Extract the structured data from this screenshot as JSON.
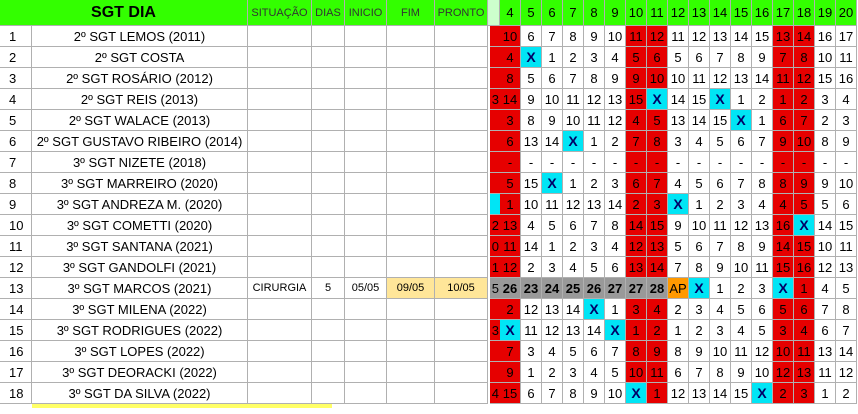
{
  "header": {
    "title": "SGT DIA",
    "columns": [
      "SITUAÇÃO",
      "DIAS",
      "INICIO",
      "FIM",
      "PRONTO"
    ],
    "days": [
      "4",
      "5",
      "6",
      "7",
      "8",
      "9",
      "10",
      "11",
      "12",
      "13",
      "14",
      "15",
      "16",
      "17",
      "18",
      "19",
      "20"
    ]
  },
  "colors": {
    "header_green": "#33ff00",
    "header_green_light": "#ccffcc",
    "red": "#e60000",
    "cyan": "#00e5f5",
    "gray": "#999999",
    "light_tan": "#ffe699",
    "orange": "#ff9900"
  },
  "rows": [
    {
      "n": "1",
      "name": "2º SGT LEMOS (2011)",
      "sit": "",
      "dias": "",
      "ini": "",
      "fim": "",
      "pronto": "",
      "pre": "",
      "pre_c": "r",
      "cells": [
        "10",
        "6",
        "7",
        "8",
        "9",
        "10",
        "11",
        "12",
        "11",
        "12",
        "13",
        "14",
        "15",
        "13",
        "14",
        "16",
        "17"
      ],
      "colors": [
        "r",
        "w",
        "w",
        "w",
        "w",
        "w",
        "r",
        "r",
        "w",
        "w",
        "w",
        "w",
        "w",
        "r",
        "r",
        "w",
        "w"
      ]
    },
    {
      "n": "2",
      "name": "2º SGT COSTA",
      "sit": "",
      "dias": "",
      "ini": "",
      "fim": "",
      "pronto": "",
      "pre": "",
      "pre_c": "r",
      "cells": [
        "4",
        "X",
        "1",
        "2",
        "3",
        "4",
        "5",
        "6",
        "5",
        "6",
        "7",
        "8",
        "9",
        "7",
        "8",
        "10",
        "11"
      ],
      "colors": [
        "r",
        "c",
        "w",
        "w",
        "w",
        "w",
        "r",
        "r",
        "w",
        "w",
        "w",
        "w",
        "w",
        "r",
        "r",
        "w",
        "w"
      ]
    },
    {
      "n": "3",
      "name": "2º SGT ROSÁRIO (2012)",
      "sit": "",
      "dias": "",
      "ini": "",
      "fim": "",
      "pronto": "",
      "pre": "",
      "pre_c": "r",
      "cells": [
        "8",
        "5",
        "6",
        "7",
        "8",
        "9",
        "9",
        "10",
        "10",
        "11",
        "12",
        "13",
        "14",
        "11",
        "12",
        "15",
        "16"
      ],
      "colors": [
        "r",
        "w",
        "w",
        "w",
        "w",
        "w",
        "r",
        "r",
        "w",
        "w",
        "w",
        "w",
        "w",
        "r",
        "r",
        "w",
        "w"
      ]
    },
    {
      "n": "4",
      "name": "2º SGT REIS (2013)",
      "sit": "",
      "dias": "",
      "ini": "",
      "fim": "",
      "pronto": "",
      "pre": "3",
      "pre_c": "r",
      "cells": [
        "14",
        "9",
        "10",
        "11",
        "12",
        "13",
        "15",
        "X",
        "14",
        "15",
        "X",
        "1",
        "2",
        "1",
        "2",
        "3",
        "4"
      ],
      "colors": [
        "r",
        "w",
        "w",
        "w",
        "w",
        "w",
        "r",
        "c",
        "w",
        "w",
        "c",
        "w",
        "w",
        "r",
        "r",
        "w",
        "w"
      ]
    },
    {
      "n": "5",
      "name": "2º SGT WALACE (2013)",
      "sit": "",
      "dias": "",
      "ini": "",
      "fim": "",
      "pronto": "",
      "pre": "",
      "pre_c": "r",
      "cells": [
        "3",
        "8",
        "9",
        "10",
        "11",
        "12",
        "4",
        "5",
        "13",
        "14",
        "15",
        "X",
        "1",
        "6",
        "7",
        "2",
        "3"
      ],
      "colors": [
        "r",
        "w",
        "w",
        "w",
        "w",
        "w",
        "r",
        "r",
        "w",
        "w",
        "w",
        "c",
        "w",
        "r",
        "r",
        "w",
        "w"
      ]
    },
    {
      "n": "6",
      "name": "2º SGT GUSTAVO RIBEIRO (2014)",
      "sit": "",
      "dias": "",
      "ini": "",
      "fim": "",
      "pronto": "",
      "pre": "",
      "pre_c": "r",
      "cells": [
        "6",
        "13",
        "14",
        "X",
        "1",
        "2",
        "7",
        "8",
        "3",
        "4",
        "5",
        "6",
        "7",
        "9",
        "10",
        "8",
        "9"
      ],
      "colors": [
        "r",
        "w",
        "w",
        "c",
        "w",
        "w",
        "r",
        "r",
        "w",
        "w",
        "w",
        "w",
        "w",
        "r",
        "r",
        "w",
        "w"
      ]
    },
    {
      "n": "7",
      "name": "3º SGT  NIZETE  (2018)",
      "sit": "",
      "dias": "",
      "ini": "",
      "fim": "",
      "pronto": "",
      "pre": "",
      "pre_c": "r",
      "cells": [
        "-",
        "-",
        "-",
        "-",
        "-",
        "-",
        "-",
        "-",
        "-",
        "-",
        "-",
        "-",
        "-",
        "-",
        "-",
        "-",
        "-"
      ],
      "colors": [
        "r",
        "w",
        "w",
        "w",
        "w",
        "w",
        "r",
        "r",
        "w",
        "w",
        "w",
        "w",
        "w",
        "r",
        "r",
        "w",
        "w"
      ]
    },
    {
      "n": "8",
      "name": "3º SGT MARREIRO (2020)",
      "sit": "",
      "dias": "",
      "ini": "",
      "fim": "",
      "pronto": "",
      "pre": "",
      "pre_c": "r",
      "cells": [
        "5",
        "15",
        "X",
        "1",
        "2",
        "3",
        "6",
        "7",
        "4",
        "5",
        "6",
        "7",
        "8",
        "8",
        "9",
        "9",
        "10"
      ],
      "colors": [
        "r",
        "w",
        "c",
        "w",
        "w",
        "w",
        "r",
        "r",
        "w",
        "w",
        "w",
        "w",
        "w",
        "r",
        "r",
        "w",
        "w"
      ]
    },
    {
      "n": "9",
      "name": "3º SGT ANDREZA M. (2020)",
      "sit": "",
      "dias": "",
      "ini": "",
      "fim": "",
      "pronto": "",
      "pre": "",
      "pre_c": "c",
      "cells": [
        "1",
        "10",
        "11",
        "12",
        "13",
        "14",
        "2",
        "3",
        "X",
        "1",
        "2",
        "3",
        "4",
        "4",
        "5",
        "5",
        "6"
      ],
      "colors": [
        "r",
        "w",
        "w",
        "w",
        "w",
        "w",
        "r",
        "r",
        "c",
        "w",
        "w",
        "w",
        "w",
        "r",
        "r",
        "w",
        "w"
      ]
    },
    {
      "n": "10",
      "name": "3º SGT COMETTI (2020)",
      "sit": "",
      "dias": "",
      "ini": "",
      "fim": "",
      "pronto": "",
      "pre": "2",
      "pre_c": "r",
      "cells": [
        "13",
        "4",
        "5",
        "6",
        "7",
        "8",
        "14",
        "15",
        "9",
        "10",
        "11",
        "12",
        "13",
        "16",
        "X",
        "14",
        "15"
      ],
      "colors": [
        "r",
        "w",
        "w",
        "w",
        "w",
        "w",
        "r",
        "r",
        "w",
        "w",
        "w",
        "w",
        "w",
        "r",
        "c",
        "w",
        "w"
      ]
    },
    {
      "n": "11",
      "name": "3º SGT SANTANA (2021)",
      "sit": "",
      "dias": "",
      "ini": "",
      "fim": "",
      "pronto": "",
      "pre": "0",
      "pre_c": "r",
      "cells": [
        "11",
        "14",
        "1",
        "2",
        "3",
        "4",
        "12",
        "13",
        "5",
        "6",
        "7",
        "8",
        "9",
        "14",
        "15",
        "10",
        "11"
      ],
      "colors": [
        "r",
        "w",
        "w",
        "w",
        "w",
        "w",
        "r",
        "r",
        "w",
        "w",
        "w",
        "w",
        "w",
        "r",
        "r",
        "w",
        "w"
      ]
    },
    {
      "n": "12",
      "name": "3º SGT GANDOLFI (2021)",
      "sit": "",
      "dias": "",
      "ini": "",
      "fim": "",
      "pronto": "",
      "pre": "1",
      "pre_c": "r",
      "cells": [
        "12",
        "2",
        "3",
        "4",
        "5",
        "6",
        "13",
        "14",
        "7",
        "8",
        "9",
        "10",
        "11",
        "15",
        "16",
        "12",
        "13"
      ],
      "colors": [
        "r",
        "w",
        "w",
        "w",
        "w",
        "w",
        "r",
        "r",
        "w",
        "w",
        "w",
        "w",
        "w",
        "r",
        "r",
        "w",
        "w"
      ]
    },
    {
      "n": "13",
      "name": "3º SGT MARCOS  (2021)",
      "sit": "CIRURGIA",
      "dias": "5",
      "ini": "05/05",
      "fim": "09/05",
      "pronto": "10/05",
      "pre": "5",
      "pre_c": "g",
      "cells": [
        "26",
        "23",
        "24",
        "25",
        "26",
        "27",
        "27",
        "28",
        "AP",
        "X",
        "1",
        "2",
        "3",
        "X",
        "1",
        "4",
        "5"
      ],
      "colors": [
        "g",
        "g",
        "g",
        "g",
        "g",
        "g",
        "g",
        "g",
        "o",
        "c",
        "w",
        "w",
        "w",
        "c",
        "r",
        "w",
        "w"
      ]
    },
    {
      "n": "14",
      "name": "3º SGT MILENA (2022)",
      "sit": "",
      "dias": "",
      "ini": "",
      "fim": "",
      "pronto": "",
      "pre": "",
      "pre_c": "r",
      "cells": [
        "2",
        "12",
        "13",
        "14",
        "X",
        "1",
        "3",
        "4",
        "2",
        "3",
        "4",
        "5",
        "6",
        "5",
        "6",
        "7",
        "8"
      ],
      "colors": [
        "r",
        "w",
        "w",
        "w",
        "c",
        "w",
        "r",
        "r",
        "w",
        "w",
        "w",
        "w",
        "w",
        "r",
        "r",
        "w",
        "w"
      ]
    },
    {
      "n": "15",
      "name": "3º SGT RODRIGUES (2022)",
      "sit": "",
      "dias": "",
      "ini": "",
      "fim": "",
      "pronto": "",
      "pre": "3",
      "pre_c": "r",
      "cells": [
        "X",
        "11",
        "12",
        "13",
        "14",
        "X",
        "1",
        "2",
        "1",
        "2",
        "3",
        "4",
        "5",
        "3",
        "4",
        "6",
        "7"
      ],
      "colors": [
        "c",
        "w",
        "w",
        "w",
        "w",
        "c",
        "r",
        "r",
        "w",
        "w",
        "w",
        "w",
        "w",
        "r",
        "r",
        "w",
        "w"
      ]
    },
    {
      "n": "16",
      "name": "3º SGT LOPES (2022)",
      "sit": "",
      "dias": "",
      "ini": "",
      "fim": "",
      "pronto": "",
      "pre": "",
      "pre_c": "r",
      "cells": [
        "7",
        "3",
        "4",
        "5",
        "6",
        "7",
        "8",
        "9",
        "8",
        "9",
        "10",
        "11",
        "12",
        "10",
        "11",
        "13",
        "14"
      ],
      "colors": [
        "r",
        "w",
        "w",
        "w",
        "w",
        "w",
        "r",
        "r",
        "w",
        "w",
        "w",
        "w",
        "w",
        "r",
        "r",
        "w",
        "w"
      ]
    },
    {
      "n": "17",
      "name": "3º SGT DEORACKI (2022)",
      "sit": "",
      "dias": "",
      "ini": "",
      "fim": "",
      "pronto": "",
      "pre": "",
      "pre_c": "r",
      "cells": [
        "9",
        "1",
        "2",
        "3",
        "4",
        "5",
        "10",
        "11",
        "6",
        "7",
        "8",
        "9",
        "10",
        "12",
        "13",
        "11",
        "12"
      ],
      "colors": [
        "r",
        "w",
        "w",
        "w",
        "w",
        "w",
        "r",
        "r",
        "w",
        "w",
        "w",
        "w",
        "w",
        "r",
        "r",
        "w",
        "w"
      ]
    },
    {
      "n": "18",
      "name": "3º SGT DA SILVA (2022)",
      "sit": "",
      "dias": "",
      "ini": "",
      "fim": "",
      "pronto": "",
      "pre": "4",
      "pre_c": "r",
      "cells": [
        "15",
        "6",
        "7",
        "8",
        "9",
        "10",
        "X",
        "1",
        "12",
        "13",
        "14",
        "15",
        "X",
        "2",
        "3",
        "1",
        "2"
      ],
      "colors": [
        "r",
        "w",
        "w",
        "w",
        "w",
        "w",
        "c",
        "r",
        "w",
        "w",
        "w",
        "w",
        "c",
        "r",
        "r",
        "w",
        "w"
      ]
    }
  ]
}
